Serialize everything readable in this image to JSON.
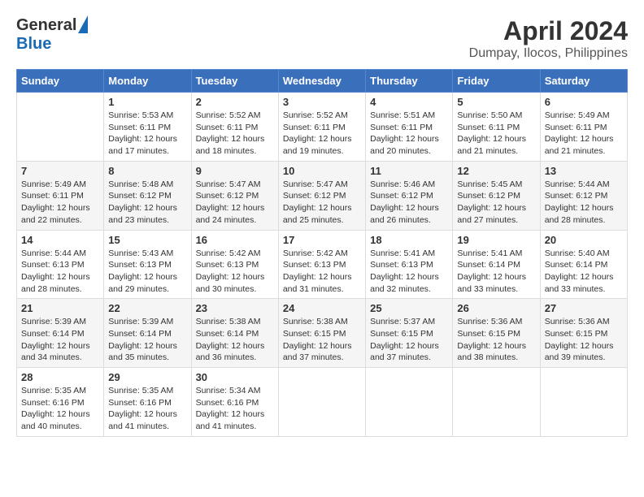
{
  "logo": {
    "line1": "General",
    "line2": "Blue"
  },
  "title": "April 2024",
  "subtitle": "Dumpay, Ilocos, Philippines",
  "days_header": [
    "Sunday",
    "Monday",
    "Tuesday",
    "Wednesday",
    "Thursday",
    "Friday",
    "Saturday"
  ],
  "weeks": [
    [
      {
        "num": "",
        "info": ""
      },
      {
        "num": "1",
        "info": "Sunrise: 5:53 AM\nSunset: 6:11 PM\nDaylight: 12 hours\nand 17 minutes."
      },
      {
        "num": "2",
        "info": "Sunrise: 5:52 AM\nSunset: 6:11 PM\nDaylight: 12 hours\nand 18 minutes."
      },
      {
        "num": "3",
        "info": "Sunrise: 5:52 AM\nSunset: 6:11 PM\nDaylight: 12 hours\nand 19 minutes."
      },
      {
        "num": "4",
        "info": "Sunrise: 5:51 AM\nSunset: 6:11 PM\nDaylight: 12 hours\nand 20 minutes."
      },
      {
        "num": "5",
        "info": "Sunrise: 5:50 AM\nSunset: 6:11 PM\nDaylight: 12 hours\nand 21 minutes."
      },
      {
        "num": "6",
        "info": "Sunrise: 5:49 AM\nSunset: 6:11 PM\nDaylight: 12 hours\nand 21 minutes."
      }
    ],
    [
      {
        "num": "7",
        "info": "Sunrise: 5:49 AM\nSunset: 6:11 PM\nDaylight: 12 hours\nand 22 minutes."
      },
      {
        "num": "8",
        "info": "Sunrise: 5:48 AM\nSunset: 6:12 PM\nDaylight: 12 hours\nand 23 minutes."
      },
      {
        "num": "9",
        "info": "Sunrise: 5:47 AM\nSunset: 6:12 PM\nDaylight: 12 hours\nand 24 minutes."
      },
      {
        "num": "10",
        "info": "Sunrise: 5:47 AM\nSunset: 6:12 PM\nDaylight: 12 hours\nand 25 minutes."
      },
      {
        "num": "11",
        "info": "Sunrise: 5:46 AM\nSunset: 6:12 PM\nDaylight: 12 hours\nand 26 minutes."
      },
      {
        "num": "12",
        "info": "Sunrise: 5:45 AM\nSunset: 6:12 PM\nDaylight: 12 hours\nand 27 minutes."
      },
      {
        "num": "13",
        "info": "Sunrise: 5:44 AM\nSunset: 6:12 PM\nDaylight: 12 hours\nand 28 minutes."
      }
    ],
    [
      {
        "num": "14",
        "info": "Sunrise: 5:44 AM\nSunset: 6:13 PM\nDaylight: 12 hours\nand 28 minutes."
      },
      {
        "num": "15",
        "info": "Sunrise: 5:43 AM\nSunset: 6:13 PM\nDaylight: 12 hours\nand 29 minutes."
      },
      {
        "num": "16",
        "info": "Sunrise: 5:42 AM\nSunset: 6:13 PM\nDaylight: 12 hours\nand 30 minutes."
      },
      {
        "num": "17",
        "info": "Sunrise: 5:42 AM\nSunset: 6:13 PM\nDaylight: 12 hours\nand 31 minutes."
      },
      {
        "num": "18",
        "info": "Sunrise: 5:41 AM\nSunset: 6:13 PM\nDaylight: 12 hours\nand 32 minutes."
      },
      {
        "num": "19",
        "info": "Sunrise: 5:41 AM\nSunset: 6:14 PM\nDaylight: 12 hours\nand 33 minutes."
      },
      {
        "num": "20",
        "info": "Sunrise: 5:40 AM\nSunset: 6:14 PM\nDaylight: 12 hours\nand 33 minutes."
      }
    ],
    [
      {
        "num": "21",
        "info": "Sunrise: 5:39 AM\nSunset: 6:14 PM\nDaylight: 12 hours\nand 34 minutes."
      },
      {
        "num": "22",
        "info": "Sunrise: 5:39 AM\nSunset: 6:14 PM\nDaylight: 12 hours\nand 35 minutes."
      },
      {
        "num": "23",
        "info": "Sunrise: 5:38 AM\nSunset: 6:14 PM\nDaylight: 12 hours\nand 36 minutes."
      },
      {
        "num": "24",
        "info": "Sunrise: 5:38 AM\nSunset: 6:15 PM\nDaylight: 12 hours\nand 37 minutes."
      },
      {
        "num": "25",
        "info": "Sunrise: 5:37 AM\nSunset: 6:15 PM\nDaylight: 12 hours\nand 37 minutes."
      },
      {
        "num": "26",
        "info": "Sunrise: 5:36 AM\nSunset: 6:15 PM\nDaylight: 12 hours\nand 38 minutes."
      },
      {
        "num": "27",
        "info": "Sunrise: 5:36 AM\nSunset: 6:15 PM\nDaylight: 12 hours\nand 39 minutes."
      }
    ],
    [
      {
        "num": "28",
        "info": "Sunrise: 5:35 AM\nSunset: 6:16 PM\nDaylight: 12 hours\nand 40 minutes."
      },
      {
        "num": "29",
        "info": "Sunrise: 5:35 AM\nSunset: 6:16 PM\nDaylight: 12 hours\nand 41 minutes."
      },
      {
        "num": "30",
        "info": "Sunrise: 5:34 AM\nSunset: 6:16 PM\nDaylight: 12 hours\nand 41 minutes."
      },
      {
        "num": "",
        "info": ""
      },
      {
        "num": "",
        "info": ""
      },
      {
        "num": "",
        "info": ""
      },
      {
        "num": "",
        "info": ""
      }
    ]
  ]
}
